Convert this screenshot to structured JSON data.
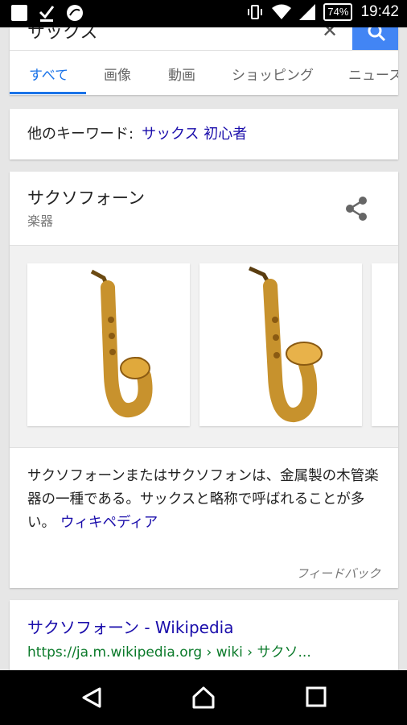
{
  "status_bar": {
    "battery": "74%",
    "time": "19:42"
  },
  "search": {
    "query": "サックス"
  },
  "tabs": [
    {
      "label": "すべて"
    },
    {
      "label": "画像"
    },
    {
      "label": "動画"
    },
    {
      "label": "ショッピング"
    },
    {
      "label": "ニュース"
    }
  ],
  "related": {
    "prefix": "他のキーワード:",
    "link": "サックス 初心者"
  },
  "knowledge": {
    "title": "サクソフォーン",
    "subtitle": "楽器",
    "description": "サクソフォーンまたはサクソフォンは、金属製の木管楽器の一種である。サックスと略称で呼ばれることが多い。",
    "source_link": "ウィキペディア",
    "feedback": "フィードバック"
  },
  "result": {
    "title": "サクソフォーン - Wikipedia",
    "url": "https://ja.m.wikipedia.org › wiki › サクソ..."
  },
  "colors": {
    "accent": "#4285f4",
    "link": "#1a0dab",
    "url_green": "#0b7a2a"
  }
}
